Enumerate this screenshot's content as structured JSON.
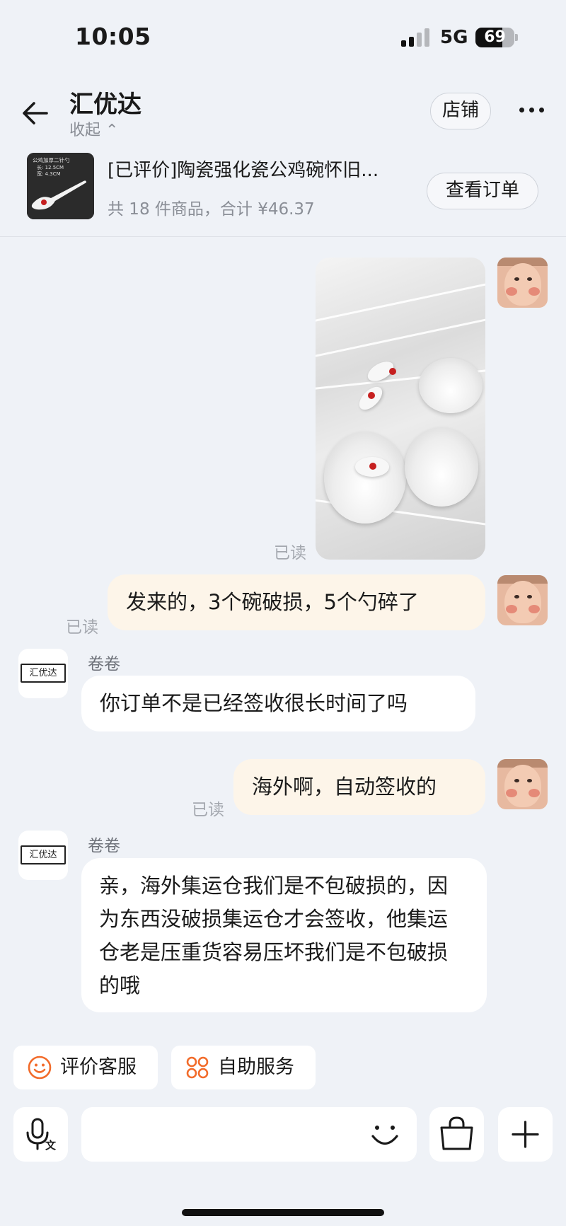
{
  "status_bar": {
    "time": "10:05",
    "network": "5G",
    "battery": "69",
    "battery_level": 0.69,
    "signal_bars_active": 2,
    "signal_bars_total": 4
  },
  "header": {
    "title": "汇优达",
    "collapse_label": "收起 ⌃",
    "store_button": "店铺"
  },
  "order": {
    "thumb_text": "公鸡加厚二针勺\n长: 12.5CM\n宽: 4.3CM",
    "title": "[已评价]陶瓷强化瓷公鸡碗怀旧...",
    "summary": "共 18 件商品，合计 ¥46.37",
    "view_button": "查看订单"
  },
  "messages": {
    "read_label": "已读",
    "shop_avatar_text": "汇优达",
    "m2_text": "发来的，3个碗破损，5个勺碎了",
    "m3_sender": "卷卷",
    "m3_text": "你订单不是已经签收很长时间了吗",
    "m4_text": "海外啊，自动签收的",
    "m5_sender": "卷卷",
    "m5_text": "亲，海外集运仓我们是不包破损的，因为东西没破损集运仓才会签收，他集运仓老是压重货容易压坏我们是不包破损的哦"
  },
  "quick_actions": {
    "rate": "评价客服",
    "self_service": "自助服务"
  },
  "colors": {
    "background": "#eff2f7",
    "my_bubble": "#fdf5e9",
    "their_bubble": "#ffffff",
    "accent": "#f26b2a"
  }
}
